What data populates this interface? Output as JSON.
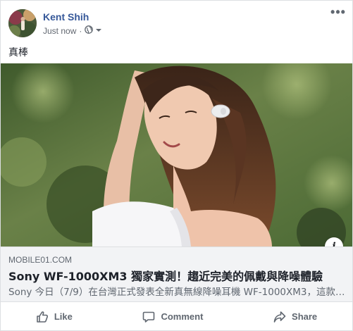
{
  "post": {
    "author": "Kent Shih",
    "timestamp": "Just now",
    "separator": "·",
    "audience_icon": "globe-icon",
    "menu_icon": "more-options-icon",
    "more_label": "•••",
    "text": "真棒"
  },
  "link_preview": {
    "domain": "MOBILE01.COM",
    "title": "Sony WF-1000XM3 獨家實測！趨近完美的佩戴與降噪體驗",
    "description": "Sony 今日（7/9）在台灣正式發表全新真無線降噪耳機 WF-1000XM3，這款耳機...",
    "info_label": "i"
  },
  "actions": {
    "like": "Like",
    "comment": "Comment",
    "share": "Share"
  },
  "colors": {
    "author_link": "#365899",
    "secondary_text": "#606770",
    "link_box_bg": "#f2f3f5",
    "border": "#dddfe2"
  }
}
